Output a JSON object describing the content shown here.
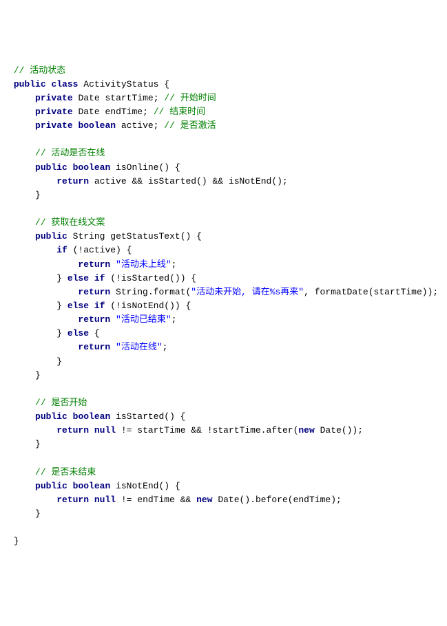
{
  "c": {
    "l1": "// 活动状态",
    "l5": "// 开始时间",
    "l6": "// 结束时间",
    "l7": "// 是否激活",
    "l9": "// 活动是否在线",
    "l14": "// 获取在线文案",
    "l27": "// 是否开始",
    "l32": "// 是否未结束"
  },
  "k": {
    "public": "public",
    "class": "class",
    "private": "private",
    "boolean": "boolean",
    "return": "return",
    "if": "if",
    "else": "else",
    "new": "new",
    "null": "null"
  },
  "id": {
    "ActivityStatus": "ActivityStatus",
    "Date": "Date",
    "startTime": "startTime",
    "endTime": "endTime",
    "active": "active",
    "isOnline": "isOnline",
    "isStarted": "isStarted",
    "isNotEnd": "isNotEnd",
    "String": "String",
    "getStatusText": "getStatusText",
    "format": "format",
    "formatDate": "formatDate",
    "after": "after",
    "before": "before"
  },
  "s": {
    "s1": "\"活动未上线\"",
    "s2": "\"活动未开始, 请在%s再来\"",
    "s3": "\"活动已结束\"",
    "s4": "\"活动在线\""
  }
}
